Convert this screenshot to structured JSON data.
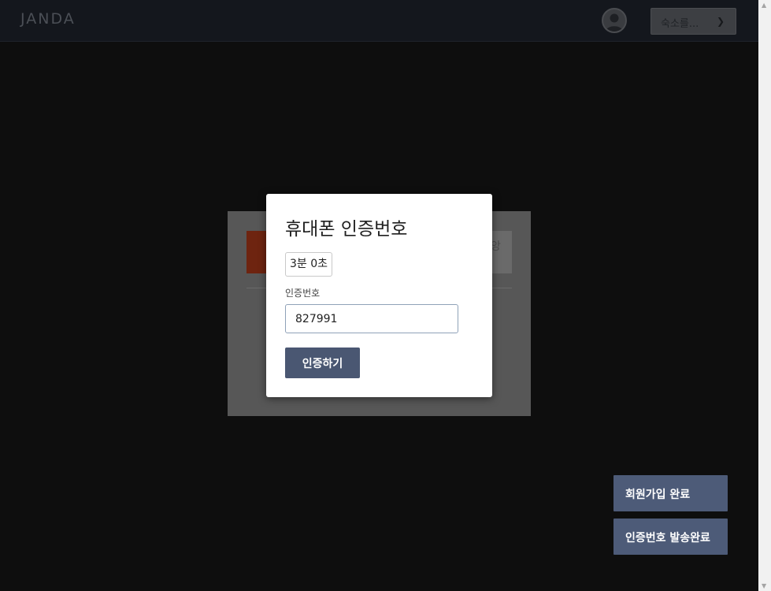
{
  "header": {
    "logo": "JANDA",
    "account_select": {
      "label": "숙소를..."
    }
  },
  "background_card": {
    "gray_button_text": "앙"
  },
  "modal": {
    "title": "휴대폰 인증번호",
    "timer": "3분  0초",
    "field_label": "인증번호",
    "code_value": "827991",
    "verify_button": "인증하기"
  },
  "toasts": [
    {
      "text": "회원가입 완료"
    },
    {
      "text": "인증번호 발송완료"
    }
  ],
  "icons": {
    "avatar": "user-avatar-icon",
    "chevron": "chevron-down-icon",
    "scroll_up": "scroll-up-arrow",
    "scroll_down": "scroll-down-arrow"
  },
  "colors": {
    "header_bg": "#14171d",
    "overlay_bg": "#0e0e0e",
    "primary_button": "#4a5772",
    "toast_bg": "#4d5b78",
    "accent_red": "#6e2410"
  }
}
